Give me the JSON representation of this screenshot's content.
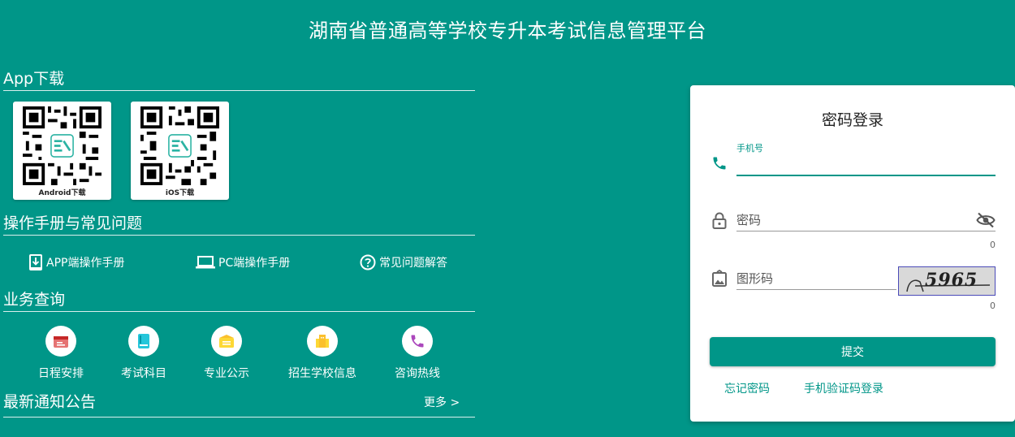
{
  "header": {
    "title": "湖南省普通高等学校专升本考试信息管理平台"
  },
  "app_download": {
    "heading": "App下载",
    "android_label": "Android下载",
    "ios_label": "iOS下载"
  },
  "manuals": {
    "heading": "操作手册与常见问题",
    "items": [
      {
        "label": "APP端操作手册",
        "icon": "mobile-download-icon"
      },
      {
        "label": "PC端操作手册",
        "icon": "laptop-icon"
      },
      {
        "label": "常见问题解答",
        "icon": "help-circle-icon"
      }
    ]
  },
  "business": {
    "heading": "业务查询",
    "items": [
      {
        "label": "日程安排",
        "icon": "calendar-icon",
        "color": "#e57373"
      },
      {
        "label": "考试科目",
        "icon": "book-icon",
        "color": "#26c6da"
      },
      {
        "label": "专业公示",
        "icon": "folder-icon",
        "color": "#fbc02d"
      },
      {
        "label": "招生学校信息",
        "icon": "building-icon",
        "color": "#fdd835"
      },
      {
        "label": "咨询热线",
        "icon": "phone-icon",
        "color": "#ab47bc"
      }
    ]
  },
  "news": {
    "heading": "最新通知公告",
    "more_label": "更多 >"
  },
  "login": {
    "title": "密码登录",
    "phone_label": "手机号",
    "phone_value": "",
    "password_placeholder": "密码",
    "password_counter": "0",
    "captcha_placeholder": "图形码",
    "captcha_counter": "0",
    "captcha_text": "5965",
    "submit_label": "提交",
    "forgot_label": "忘记密码",
    "sms_login_label": "手机验证码登录"
  },
  "colors": {
    "brand": "#009688"
  }
}
